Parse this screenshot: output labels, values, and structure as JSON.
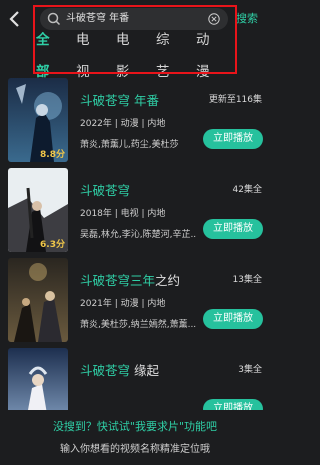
{
  "header": {
    "query": "斗破苍穹 年番",
    "search_label": "搜索"
  },
  "tabs": [
    "全部",
    "电视",
    "电影",
    "综艺",
    "动漫"
  ],
  "results": [
    {
      "title_hl": "斗破苍穹 年番",
      "title_rest": "",
      "meta": "2022年 | 动漫 | 内地",
      "cast": "萧炎,萧薰儿,药尘,美杜莎",
      "status": "更新至116集",
      "score": "8.8分",
      "play_label": "立即播放"
    },
    {
      "title_hl": "斗破苍穹",
      "title_rest": "",
      "meta": "2018年 | 电视 | 内地",
      "cast": "吴磊,林允,李沁,陈楚河,辛芷...",
      "status": "42集全",
      "score": "6.3分",
      "play_label": "立即播放"
    },
    {
      "title_hl": "斗破苍穹三年",
      "title_rest": "之约",
      "meta": "2021年 | 动漫 | 内地",
      "cast": "萧炎,美杜莎,纳兰嫣然,萧薰...",
      "status": "13集全",
      "score": "",
      "play_label": "立即播放"
    },
    {
      "title_hl": "斗破苍穹",
      "title_rest": " 缘起",
      "meta": "",
      "cast": "",
      "status": "3集全",
      "score": "",
      "play_label": "立即播放"
    }
  ],
  "footer": {
    "line1": "没搜到？快试试\"我要求片\"功能吧",
    "line2": "输入你想看的视频名称精准定位哦"
  },
  "colors": {
    "accent": "#2fcfa6",
    "highlight": "#e8141a",
    "background": "#1c1d1f"
  }
}
